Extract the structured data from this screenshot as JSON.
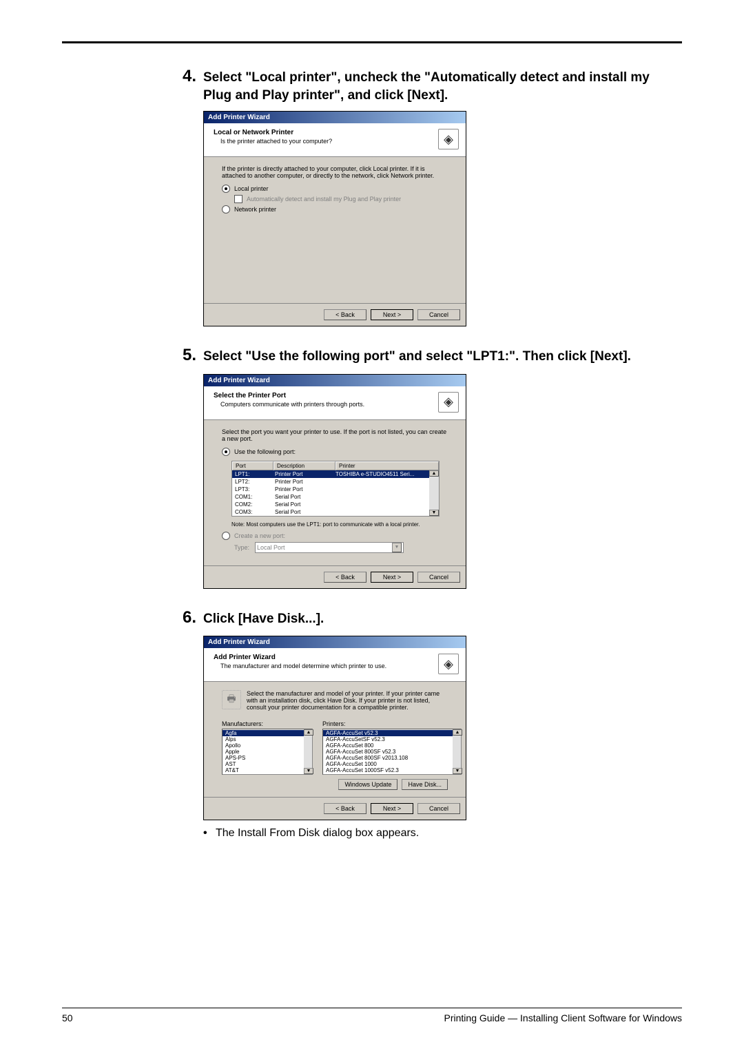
{
  "steps": {
    "s4": {
      "num": "4.",
      "text": "Select \"Local printer\", uncheck the \"Automatically detect and install my Plug and Play printer\", and click [Next]."
    },
    "s5": {
      "num": "5.",
      "text": "Select \"Use the following port\" and select \"LPT1:\".  Then click [Next]."
    },
    "s6": {
      "num": "6.",
      "text": "Click [Have Disk...]."
    }
  },
  "bullet": "The Install From Disk dialog box appears.",
  "footer": {
    "page": "50",
    "right": "Printing Guide — Installing Client Software for Windows"
  },
  "dlg1": {
    "title": "Add Printer Wizard",
    "header_title": "Local or Network Printer",
    "header_sub": "Is the printer attached to your computer?",
    "desc": "If the printer is directly attached to your computer, click Local printer.  If it is attached to another computer, or directly to the network, click Network printer.",
    "opt_local": "Local printer",
    "opt_auto": "Automatically detect and install my Plug and Play printer",
    "opt_network": "Network printer",
    "btn_back": "< Back",
    "btn_next": "Next >",
    "btn_cancel": "Cancel"
  },
  "dlg2": {
    "title": "Add Printer Wizard",
    "header_title": "Select the Printer Port",
    "header_sub": "Computers communicate with printers through ports.",
    "desc": "Select the port you want your printer to use.  If the port is not listed, you can create a new port.",
    "opt_use": "Use the following port:",
    "columns": {
      "port": "Port",
      "desc": "Description",
      "printer": "Printer"
    },
    "rows": [
      {
        "port": "LPT1:",
        "desc": "Printer Port",
        "printer": "TOSHIBA e-STUDIO4511 Seri..."
      },
      {
        "port": "LPT2:",
        "desc": "Printer Port",
        "printer": ""
      },
      {
        "port": "LPT3:",
        "desc": "Printer Port",
        "printer": ""
      },
      {
        "port": "COM1:",
        "desc": "Serial Port",
        "printer": ""
      },
      {
        "port": "COM2:",
        "desc": "Serial Port",
        "printer": ""
      },
      {
        "port": "COM3:",
        "desc": "Serial Port",
        "printer": ""
      }
    ],
    "note": "Note: Most computers use the LPT1: port to communicate with a local printer.",
    "opt_create": "Create a new port:",
    "type_label": "Type:",
    "type_value": "Local Port",
    "btn_back": "< Back",
    "btn_next": "Next >",
    "btn_cancel": "Cancel"
  },
  "dlg3": {
    "title": "Add Printer Wizard",
    "header_title": "Add Printer Wizard",
    "header_sub": "The manufacturer and model determine which printer to use.",
    "desc": "Select the manufacturer and model of your printer. If your printer came with an installation disk, click Have Disk. If your printer is not listed, consult your printer documentation for a compatible printer.",
    "manuf_label": "Manufacturers:",
    "printers_label": "Printers:",
    "manufacturers": [
      "Agfa",
      "Alps",
      "Apollo",
      "Apple",
      "APS-PS",
      "AST",
      "AT&T"
    ],
    "printers": [
      "AGFA-AccuSet v52.3",
      "AGFA-AccuSetSF v52.3",
      "AGFA-AccuSet 800",
      "AGFA-AccuSet 800SF v52.3",
      "AGFA-AccuSet 800SF v2013.108",
      "AGFA-AccuSet 1000",
      "AGFA-AccuSet 1000SF v52.3"
    ],
    "btn_winupd": "Windows Update",
    "btn_havedisk": "Have Disk...",
    "btn_back": "< Back",
    "btn_next": "Next >",
    "btn_cancel": "Cancel"
  }
}
